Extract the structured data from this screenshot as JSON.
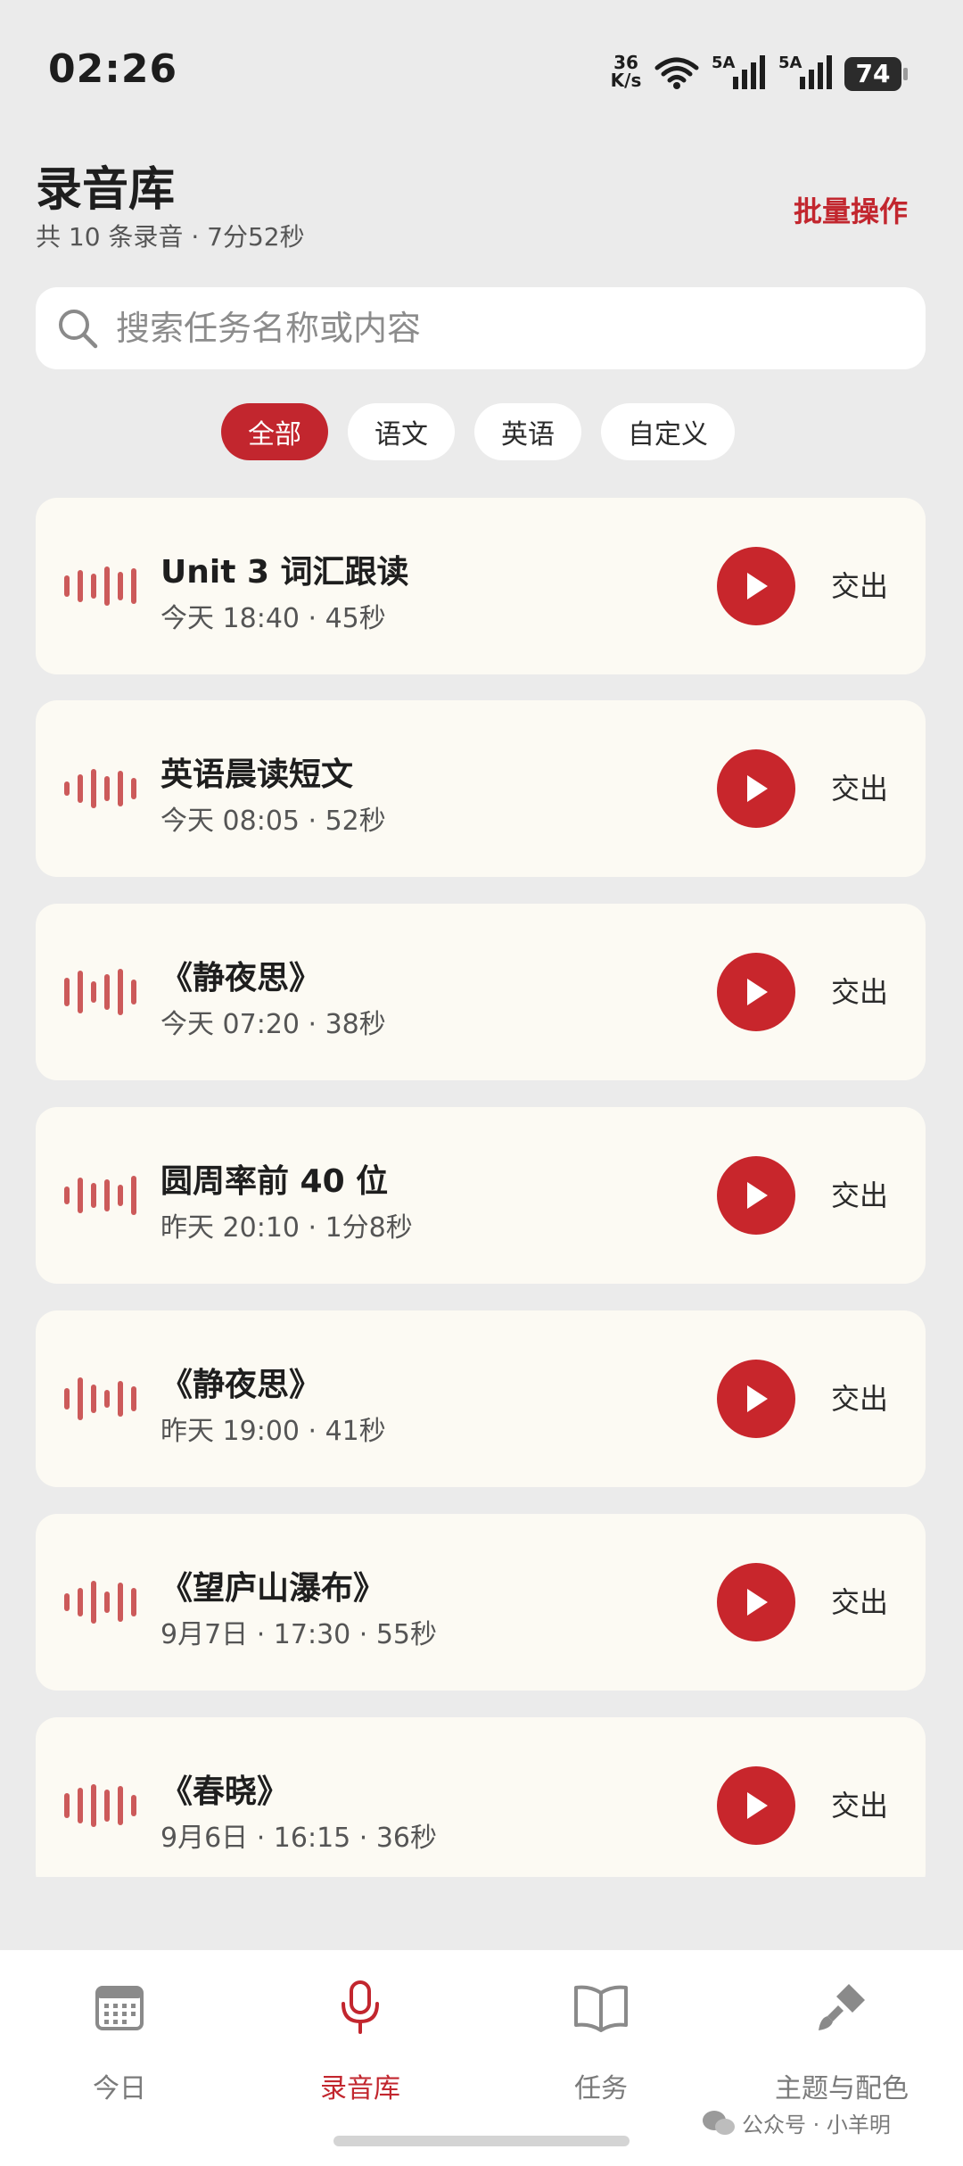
{
  "status_bar": {
    "time": "02:26",
    "net_speed_value": "36",
    "net_speed_unit": "K/s",
    "signal_1_label": "5A",
    "signal_2_label": "5A",
    "battery": "74",
    "battery_level": 0.74
  },
  "header": {
    "title": "录音库",
    "subtitle": "共 10 条录音 · 7分52秒",
    "batch_label": "批量操作"
  },
  "search": {
    "placeholder": "搜索任务名称或内容"
  },
  "filters": [
    {
      "label": "全部",
      "active": true
    },
    {
      "label": "语文",
      "active": false
    },
    {
      "label": "英语",
      "active": false
    },
    {
      "label": "自定义",
      "active": false
    }
  ],
  "recordings": [
    {
      "title": "Unit 3 词汇跟读",
      "meta": "今天 18:40 · 45秒",
      "action": "交出"
    },
    {
      "title": "英语晨读短文",
      "meta": "今天 08:05 · 52秒",
      "action": "交出"
    },
    {
      "title": "《静夜思》",
      "meta": "今天 07:20 · 38秒",
      "action": "交出"
    },
    {
      "title": "圆周率前 40 位",
      "meta": "昨天 20:10 · 1分8秒",
      "action": "交出"
    },
    {
      "title": "《静夜思》",
      "meta": "昨天 19:00 · 41秒",
      "action": "交出"
    },
    {
      "title": "《望庐山瀑布》",
      "meta": "9月7日 · 17:30 · 55秒",
      "action": "交出"
    },
    {
      "title": "《春晓》",
      "meta": "9月6日 · 16:15 · 36秒",
      "action": "交出"
    }
  ],
  "bottom_nav": [
    {
      "label": "今日",
      "icon": "calendar-icon",
      "active": false
    },
    {
      "label": "录音库",
      "icon": "microphone-icon",
      "active": true
    },
    {
      "label": "任务",
      "icon": "book-icon",
      "active": false
    },
    {
      "label": "主题与配色",
      "icon": "paint-brush-icon",
      "active": false
    }
  ],
  "watermark": "公众号 · 小羊明",
  "colors": {
    "accent": "#c2262e",
    "background": "#ebebeb",
    "card": "#fcfaf3",
    "wave": "#cc5a5a"
  }
}
